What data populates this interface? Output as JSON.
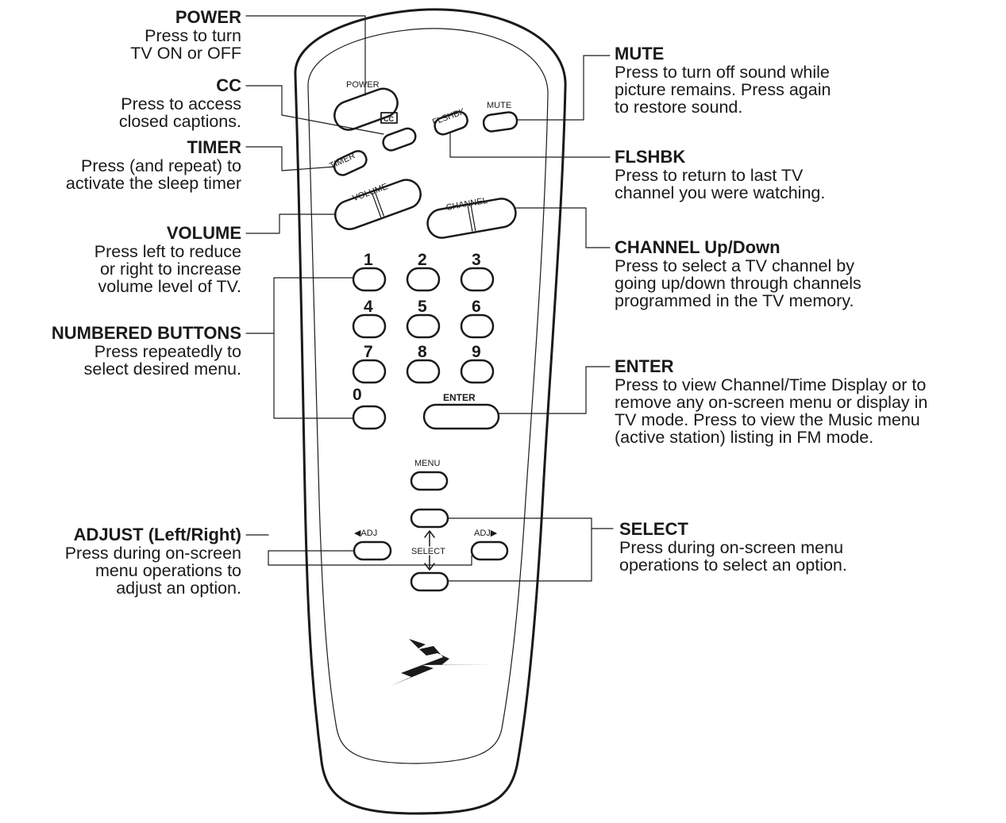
{
  "remote": {
    "buttons": {
      "power": "POWER",
      "cc": "CC",
      "flshbk": "FLSHBK",
      "mute": "MUTE",
      "timer": "TIMER",
      "volume": "VOLUME",
      "channel": "CHANNEL",
      "digits": [
        "1",
        "2",
        "3",
        "4",
        "5",
        "6",
        "7",
        "8",
        "9",
        "0"
      ],
      "enter": "ENTER",
      "menu": "MENU",
      "adj_left": "◀ADJ",
      "adj_right": "ADJ▶",
      "select": "SELECT"
    }
  },
  "annotations": {
    "power": {
      "title": "POWER",
      "desc": "Press to turn\nTV ON or OFF"
    },
    "cc": {
      "title": "CC",
      "desc": "Press to access\nclosed captions."
    },
    "timer": {
      "title": "TIMER",
      "desc": "Press (and repeat) to\nactivate the sleep timer"
    },
    "volume": {
      "title": "VOLUME",
      "desc": "Press left to reduce\nor right to increase\nvolume  level of TV."
    },
    "numbered": {
      "title": "NUMBERED BUTTONS",
      "desc": "Press repeatedly to\nselect desired menu."
    },
    "adjust": {
      "title": "ADJUST (Left/Right)",
      "desc": "Press during on-screen\nmenu operations to\nadjust an option."
    },
    "mute": {
      "title": "MUTE",
      "desc": "Press to turn off sound while\npicture remains. Press again\nto restore sound."
    },
    "flshbk": {
      "title": "FLSHBK",
      "desc": "Press to return to last TV\nchannel you were watching."
    },
    "channel": {
      "title": "CHANNEL Up/Down",
      "desc": "Press to select a TV channel by\ngoing up/down through channels\nprogrammed in the TV memory."
    },
    "enter": {
      "title": "ENTER",
      "desc": "Press to view Channel/Time Display or to\nremove any on-screen menu or display in\nTV mode. Press to view the Music menu\n(active station) listing in FM mode."
    },
    "select": {
      "title": "SELECT",
      "desc": "Press during on-screen menu\noperations to select an option."
    }
  },
  "colors": {
    "ink": "#1a1a1a",
    "background": "#ffffff"
  }
}
